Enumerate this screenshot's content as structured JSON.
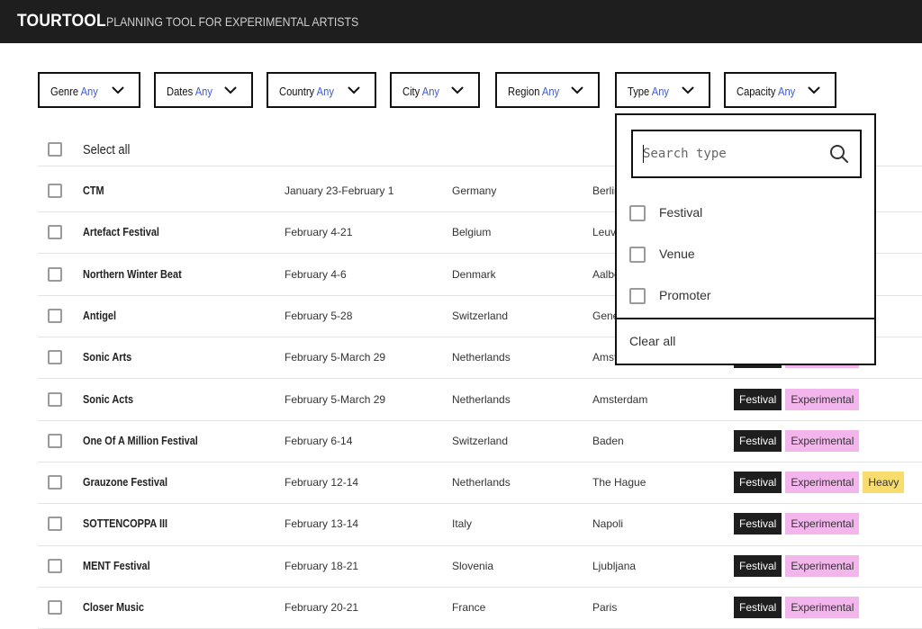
{
  "header": {
    "logo": "TOURTOOL",
    "tagline": "PLANNING TOOL FOR EXPERIMENTAL ARTISTS"
  },
  "filters": [
    {
      "label": "Genre",
      "value": "Any"
    },
    {
      "label": "Dates",
      "value": "Any"
    },
    {
      "label": "Country",
      "value": "Any"
    },
    {
      "label": "City",
      "value": "Any"
    },
    {
      "label": "Region",
      "value": "Any"
    },
    {
      "label": "Type",
      "value": "Any"
    },
    {
      "label": "Capacity",
      "value": "Any"
    }
  ],
  "table": {
    "select_all_label": "Select all",
    "rows": [
      {
        "name": "CTM",
        "dates": "January 23-February 1",
        "country": "Germany",
        "city": "Berlin",
        "tags": []
      },
      {
        "name": "Artefact Festival",
        "dates": "February 4-21",
        "country": "Belgium",
        "city": "Leuven",
        "tags": []
      },
      {
        "name": "Northern Winter Beat",
        "dates": "February 4-6",
        "country": "Denmark",
        "city": "Aalborg",
        "tags": []
      },
      {
        "name": "Antigel",
        "dates": "February 5-28",
        "country": "Switzerland",
        "city": "Geneva",
        "tags": []
      },
      {
        "name": "Sonic Arts",
        "dates": "February 5-March 29",
        "country": "Netherlands",
        "city": "Amsterdam",
        "tags": [
          "Festival",
          "Experimental"
        ]
      },
      {
        "name": "Sonic Acts",
        "dates": "February 5-March 29",
        "country": "Netherlands",
        "city": "Amsterdam",
        "tags": [
          "Festival",
          "Experimental"
        ]
      },
      {
        "name": "One Of A Million Festival",
        "dates": "February 6-14",
        "country": "Switzerland",
        "city": "Baden",
        "tags": [
          "Festival",
          "Experimental"
        ]
      },
      {
        "name": "Grauzone Festival",
        "dates": "February 12-14",
        "country": "Netherlands",
        "city": "The Hague",
        "tags": [
          "Festival",
          "Experimental",
          "Heavy"
        ]
      },
      {
        "name": "SOTTENCOPPA III",
        "dates": "February 13-14",
        "country": "Italy",
        "city": "Napoli",
        "tags": [
          "Festival",
          "Experimental"
        ]
      },
      {
        "name": "MENT Festival",
        "dates": "February 18-21",
        "country": "Slovenia",
        "city": "Ljubljana",
        "tags": [
          "Festival",
          "Experimental"
        ]
      },
      {
        "name": "Closer Music",
        "dates": "February 20-21",
        "country": "France",
        "city": "Paris",
        "tags": [
          "Festival",
          "Experimental"
        ]
      }
    ]
  },
  "dropdown": {
    "search_placeholder": "Search type",
    "options": [
      "Festival",
      "Venue",
      "Promoter"
    ],
    "clear_label": "Clear all"
  },
  "colors": {
    "topbar": "#1e1e1e",
    "accent": "#3f5bd0",
    "tag_dark": "#1e1e1e",
    "tag_pink": "#f2b5ec",
    "tag_yellow": "#f8dd6e"
  },
  "icons": {
    "filter_chevron": "chevron-down-icon",
    "search": "search-icon",
    "checkbox": "checkbox-icon"
  }
}
